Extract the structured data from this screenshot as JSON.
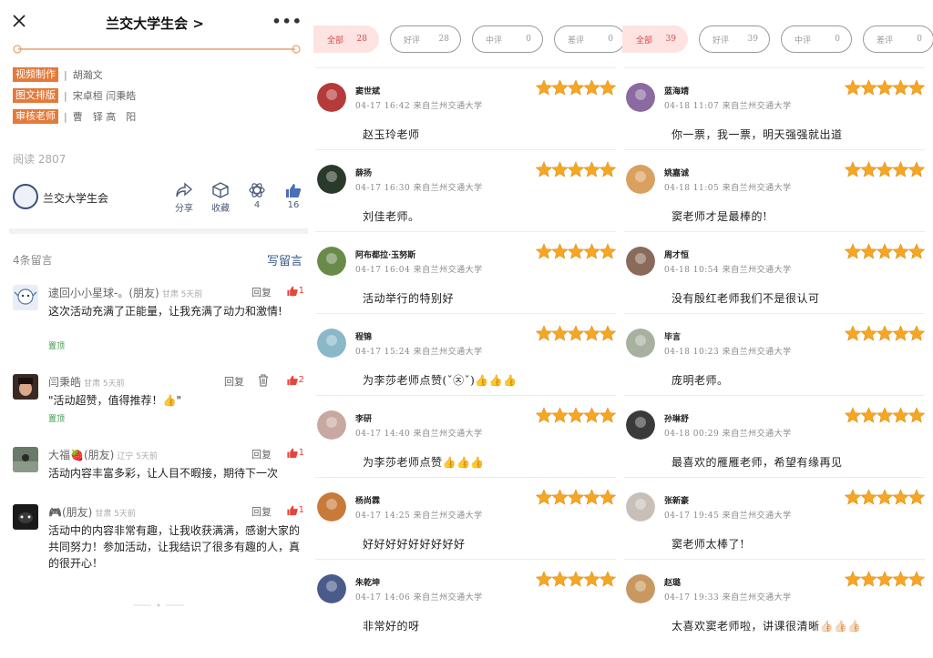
{
  "article": {
    "title": "兰交大学生会 >",
    "credits": [
      {
        "tag": "视频制作",
        "names": "胡瀚文"
      },
      {
        "tag": "图文排版",
        "names": "宋卓桓 闫秉皓"
      },
      {
        "tag": "审核老师",
        "names": "曹　铎 高　阳"
      }
    ],
    "reads": "阅读 2807",
    "account_name": "兰交大学生会",
    "actions": {
      "share": "分享",
      "collect": "收藏",
      "wow_count": "4",
      "like_count": "16"
    },
    "comments_count_label": "4条留言",
    "write_comment": "写留言",
    "comments": [
      {
        "name": "逮回小小星球-。(朋友)",
        "meta": "甘肃 5天前",
        "reply": "回复",
        "likes": "1",
        "body": "这次活动充满了正能量，让我充满了动力和激情!",
        "pinned": "置顶"
      },
      {
        "name": "闫秉皓",
        "meta": "甘肃 5天前",
        "reply": "回复",
        "likes": "2",
        "body": "\"活动超赞，值得推荐！👍\"",
        "pinned": "置顶"
      },
      {
        "name": "大福🍓(朋友)",
        "meta": "辽宁 5天前",
        "reply": "回复",
        "likes": "1",
        "body": "活动内容丰富多彩，让人目不暇接，期待下一次"
      },
      {
        "name": "🎮(朋友)",
        "meta": "甘肃 5天前",
        "reply": "回复",
        "likes": "1",
        "body": "活动中的内容非常有趣，让我收获满满，感谢大家的共同努力！参加活动，让我结识了很多有趣的人，真的很开心！"
      }
    ]
  },
  "reviews_left": {
    "filters": [
      {
        "label": "全部",
        "count": "28"
      },
      {
        "label": "好评",
        "count": "28"
      },
      {
        "label": "中评",
        "count": "0"
      },
      {
        "label": "差评",
        "count": "0"
      }
    ],
    "items": [
      {
        "name": "窦世斌",
        "meta": "04-17 16:42  来自兰州交通大学",
        "text": "赵玉玲老师",
        "rating": 5
      },
      {
        "name": "薛扬",
        "meta": "04-17 16:30  来自兰州交通大学",
        "text": "刘佳老师。",
        "rating": 5
      },
      {
        "name": "阿布都拉·玉努斯",
        "meta": "04-17 16:04  来自兰州交通大学",
        "text": "活动举行的特别好",
        "rating": 5
      },
      {
        "name": "程锦",
        "meta": "04-17 15:24  来自兰州交通大学",
        "text": "为李莎老师点赞(ˇ㉨ˇ)👍👍👍",
        "rating": 5
      },
      {
        "name": "李研",
        "meta": "04-17 14:40  来自兰州交通大学",
        "text": "为李莎老师点赞👍👍👍",
        "rating": 5
      },
      {
        "name": "杨尚霖",
        "meta": "04-17 14:25  来自兰州交通大学",
        "text": "好好好好好好好好好",
        "rating": 5
      },
      {
        "name": "朱乾坤",
        "meta": "04-17 14:06  来自兰州交通大学",
        "text": "非常好的呀",
        "rating": 5
      }
    ]
  },
  "reviews_right": {
    "filters": [
      {
        "label": "全部",
        "count": "39"
      },
      {
        "label": "好评",
        "count": "39"
      },
      {
        "label": "中评",
        "count": "0"
      },
      {
        "label": "差评",
        "count": "0"
      }
    ],
    "items": [
      {
        "name": "蓝海靖",
        "meta": "04-18 11:07  来自兰州交通大学",
        "text": "你一票，我一票，明天强强就出道",
        "rating": 5
      },
      {
        "name": "姚嘉诚",
        "meta": "04-18 11:05  来自兰州交通大学",
        "text": "窦老师才是最棒的!",
        "rating": 5
      },
      {
        "name": "周才恒",
        "meta": "04-18 10:54  来自兰州交通大学",
        "text": "没有殷红老师我们不是很认可",
        "rating": 5
      },
      {
        "name": "毕言",
        "meta": "04-18 10:23  来自兰州交通大学",
        "text": "庞明老师。",
        "rating": 5
      },
      {
        "name": "孙琳舒",
        "meta": "04-18 00:29  来自兰州交通大学",
        "text": "最喜欢的雁雁老师，希望有缘再见",
        "rating": 5
      },
      {
        "name": "张新豪",
        "meta": "04-17 19:45  来自兰州交通大学",
        "text": "窦老师太棒了!",
        "rating": 5
      },
      {
        "name": "赵璐",
        "meta": "04-17 19:33  来自兰州交通大学",
        "text": "太喜欢窦老师啦，讲课很清晰👍🏻👍🏻👍🏻",
        "rating": 5
      }
    ]
  },
  "colors": {
    "accent": "#e47a3a",
    "star": "#f5a623",
    "pill_active_bg": "#fde3e1",
    "like_red": "#e6453a",
    "link_blue": "#3a5a8c"
  },
  "icons": [
    "close-icon",
    "more-icon",
    "share-icon",
    "collect-icon",
    "wow-icon",
    "thumbs-up-icon",
    "trash-icon",
    "star-icon"
  ]
}
